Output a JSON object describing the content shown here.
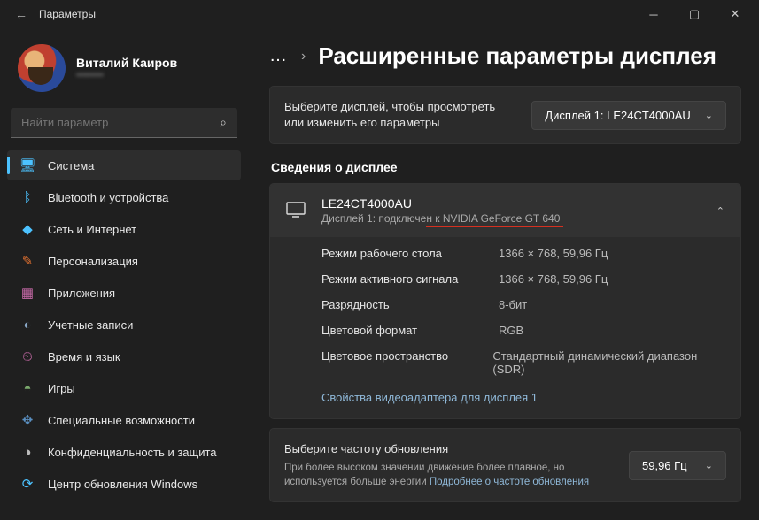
{
  "window": {
    "title": "Параметры"
  },
  "user": {
    "name": "Виталий Каиров",
    "email": "••••••••"
  },
  "search": {
    "placeholder": "Найти параметр"
  },
  "nav": [
    {
      "label": "Система",
      "icon": "🖥",
      "color": "#4cc2ff",
      "active": true
    },
    {
      "label": "Bluetooth и устройства",
      "icon": "ᛒ",
      "color": "#4cc2ff"
    },
    {
      "label": "Сеть и Интернет",
      "icon": "◆",
      "color": "#4cc2ff"
    },
    {
      "label": "Персонализация",
      "icon": "✎",
      "color": "#e07030"
    },
    {
      "label": "Приложения",
      "icon": "▦",
      "color": "#c76aa8"
    },
    {
      "label": "Учетные записи",
      "icon": "◐",
      "color": "#8aa8c8"
    },
    {
      "label": "Время и язык",
      "icon": "⏲",
      "color": "#c76aa8"
    },
    {
      "label": "Игры",
      "icon": "◓",
      "color": "#7aa86c"
    },
    {
      "label": "Специальные возможности",
      "icon": "✥",
      "color": "#5a8fc0"
    },
    {
      "label": "Конфиденциальность и защита",
      "icon": "◑",
      "color": "#bbb"
    },
    {
      "label": "Центр обновления Windows",
      "icon": "⟳",
      "color": "#4cc2ff"
    }
  ],
  "breadcrumb": {
    "title": "Расширенные параметры дисплея"
  },
  "selectDisplay": {
    "prompt": "Выберите дисплей, чтобы просмотреть или изменить его параметры",
    "value": "Дисплей 1: LE24CT4000AU"
  },
  "infoSection": {
    "title": "Сведения о дисплее"
  },
  "displayCard": {
    "title": "LE24CT4000AU",
    "sub": "Дисплей 1: подключен к NVIDIA GeForce GT 640",
    "rows": [
      {
        "k": "Режим рабочего стола",
        "v": "1366 × 768, 59,96 Гц"
      },
      {
        "k": "Режим активного сигнала",
        "v": "1366 × 768, 59,96 Гц"
      },
      {
        "k": "Разрядность",
        "v": "8-бит"
      },
      {
        "k": "Цветовой формат",
        "v": "RGB"
      },
      {
        "k": "Цветовое пространство",
        "v": "Стандартный динамический диапазон (SDR)"
      }
    ],
    "link": "Свойства видеоадаптера для дисплея 1"
  },
  "refresh": {
    "title": "Выберите частоту обновления",
    "sub": "При более высоком значении движение более плавное, но используется больше энергии ",
    "link": "Подробнее о частоте обновления",
    "value": "59,96 Гц"
  }
}
